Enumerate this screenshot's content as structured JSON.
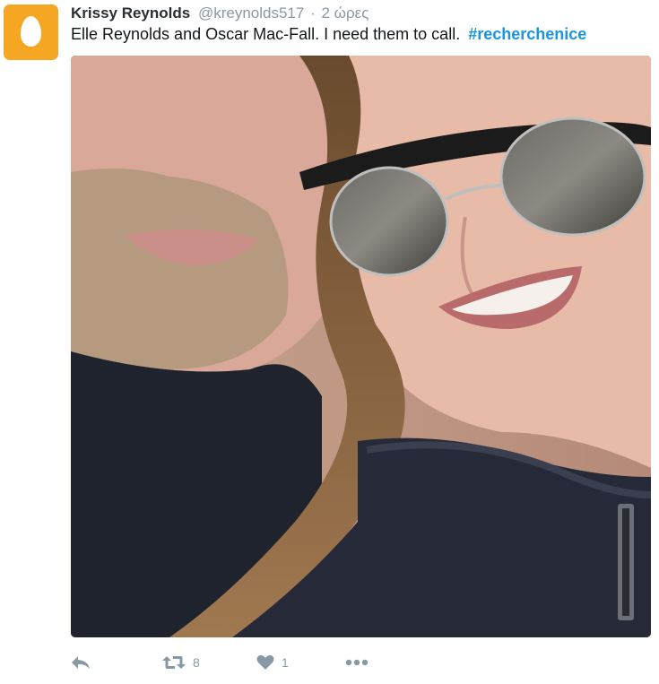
{
  "tweet": {
    "fullname": "Krissy Reynolds",
    "username": "@kreynolds517",
    "separator": "·",
    "time": "2 ώρες",
    "text": "Elle Reynolds and Oscar Mac-Fall. I need them to call.",
    "hashtag": "#recherchenice",
    "avatar_icon": "default-egg-avatar-icon",
    "media_alt": "selfie photo",
    "actions": {
      "reply_icon": "reply-icon",
      "retweet_icon": "retweet-icon",
      "retweet_count": "8",
      "like_icon": "heart-icon",
      "like_count": "1",
      "more_icon": "more-dots-icon"
    }
  },
  "colors": {
    "avatar_bg": "#f5a623",
    "hashtag": "#1b95e0",
    "muted": "#8899a6",
    "text": "#14171a"
  }
}
